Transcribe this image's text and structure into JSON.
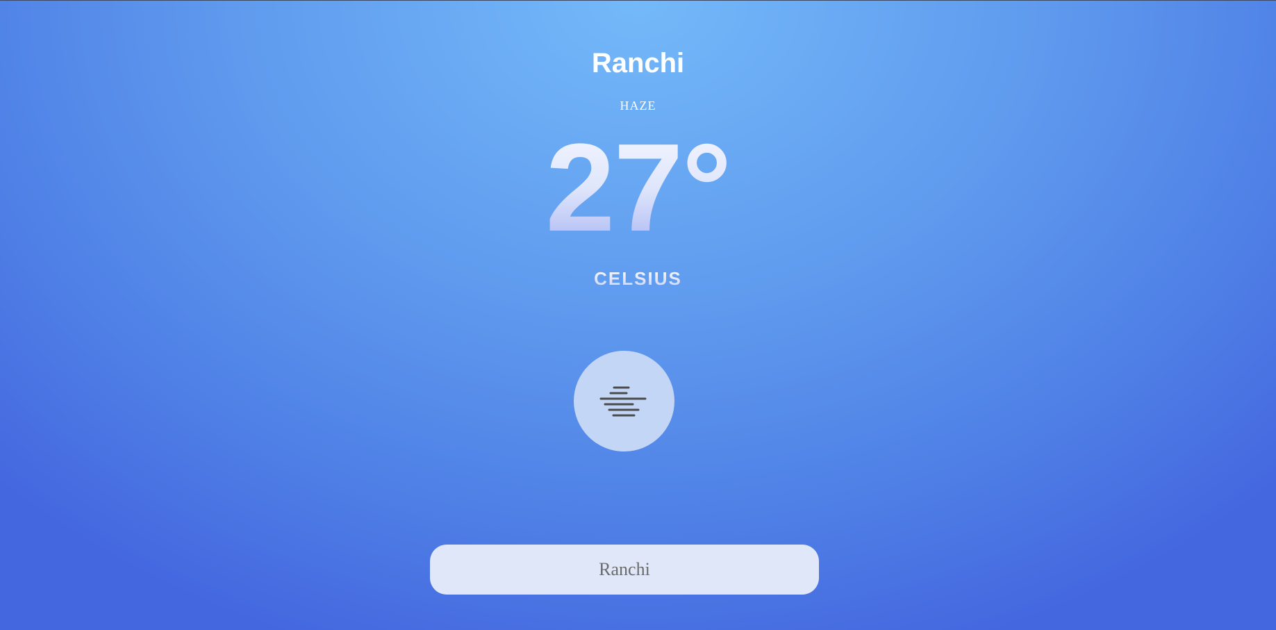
{
  "weather": {
    "city": "Ranchi",
    "condition": "HAZE",
    "temperature": "27°",
    "unit": "CELSIUS",
    "icon": "haze-icon"
  },
  "search": {
    "value": "Ranchi",
    "placeholder": ""
  },
  "colors": {
    "background_top": "#74b9f9",
    "background_bottom": "#4466df",
    "icon_circle": "#c4d6f6",
    "icon_stroke": "#4a4a4a",
    "search_bg": "#dfe7f9"
  }
}
